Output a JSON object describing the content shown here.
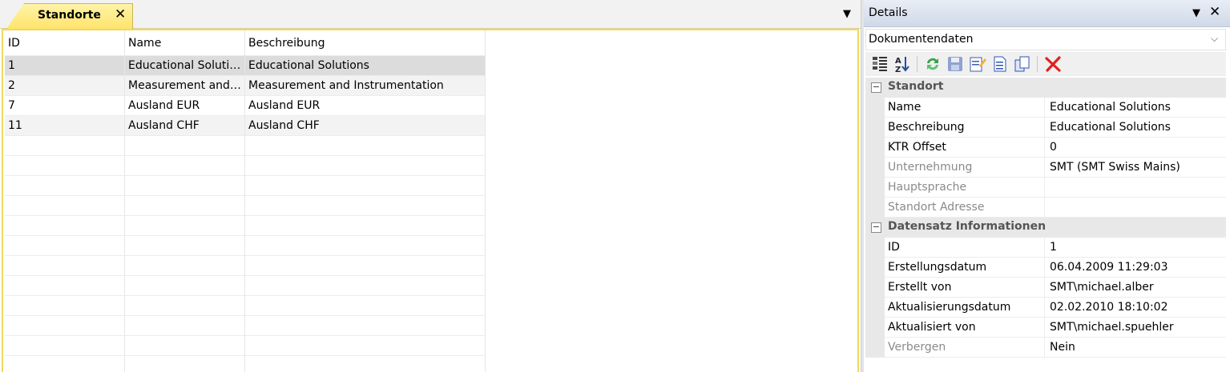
{
  "tab": {
    "title": "Standorte",
    "close_glyph": "✕"
  },
  "grid": {
    "columns": [
      "ID",
      "Name",
      "Beschreibung"
    ],
    "rows": [
      {
        "id": "1",
        "name": "Educational Solutions",
        "description": "Educational Solutions",
        "selected": true
      },
      {
        "id": "2",
        "name": "Measurement and Instrumentation",
        "description": "Measurement and Instrumentation"
      },
      {
        "id": "7",
        "name": "Ausland EUR",
        "description": "Ausland EUR"
      },
      {
        "id": "11",
        "name": "Ausland CHF",
        "description": "Ausland CHF"
      }
    ]
  },
  "details": {
    "title": "Details",
    "close_glyph": "✕",
    "combo_value": "Dokumentendaten",
    "toolbar_icons": [
      "categorized-icon",
      "sort-az-icon",
      "refresh-icon",
      "save-icon",
      "edit-icon",
      "new-document-icon",
      "copy-icon",
      "delete-icon"
    ],
    "categories": [
      {
        "label": "Standort",
        "toggle": "−",
        "properties": [
          {
            "name": "Name",
            "value": "Educational Solutions",
            "readonly": false
          },
          {
            "name": "Beschreibung",
            "value": "Educational Solutions",
            "readonly": false
          },
          {
            "name": "KTR Offset",
            "value": "0",
            "readonly": false
          },
          {
            "name": "Unternehmung",
            "value": "SMT (SMT Swiss Mains)",
            "readonly": true
          },
          {
            "name": "Hauptsprache",
            "value": "",
            "readonly": true
          },
          {
            "name": "Standort Adresse",
            "value": "",
            "readonly": true
          }
        ]
      },
      {
        "label": "Datensatz Informationen",
        "toggle": "−",
        "properties": [
          {
            "name": "ID",
            "value": "1",
            "readonly": false
          },
          {
            "name": "Erstellungsdatum",
            "value": "06.04.2009 11:29:03",
            "readonly": false
          },
          {
            "name": "Erstellt von",
            "value": "SMT\\michael.alber",
            "readonly": false
          },
          {
            "name": "Aktualisierungsdatum",
            "value": "02.02.2010 18:10:02",
            "readonly": false
          },
          {
            "name": "Aktualisiert von",
            "value": "SMT\\michael.spuehler",
            "readonly": false
          },
          {
            "name": "Verbergen",
            "value": "Nein",
            "readonly": true
          }
        ]
      }
    ]
  }
}
